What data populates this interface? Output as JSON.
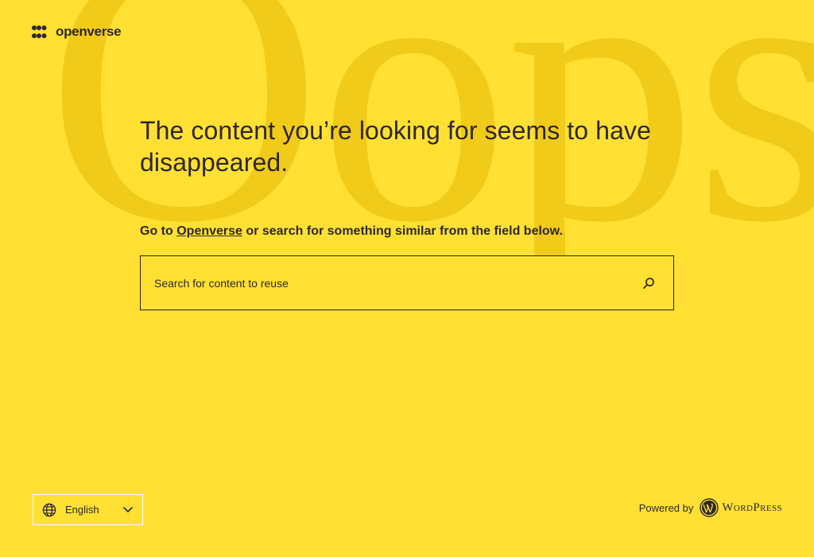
{
  "background": {
    "watermark_text": "Oops!",
    "color": "#ffe033",
    "watermark_color": "#f1cb1a"
  },
  "header": {
    "logo_text": "openverse",
    "logo_icon": "openverse-logo-icon"
  },
  "main": {
    "heading": "The content you’re looking for seems to have disappeared.",
    "subtext_prefix": "Go to ",
    "subtext_link": "Openverse",
    "subtext_suffix": " or search for something similar from the field below."
  },
  "search": {
    "placeholder": "Search for content to reuse",
    "value": "",
    "button_icon": "search-icon",
    "button_label": "Search"
  },
  "footer": {
    "language": {
      "selected": "English",
      "icon": "globe-icon",
      "chevron": "chevron-down-icon"
    },
    "powered_by_label": "Powered by",
    "wordpress_label": "WordPress",
    "wordpress_icon": "wordpress-icon"
  },
  "colors": {
    "text": "#30272e",
    "accent": "#ffe033"
  }
}
